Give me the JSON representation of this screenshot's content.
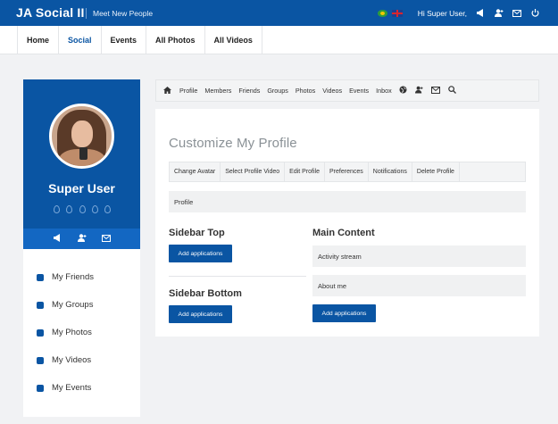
{
  "topbar": {
    "brand": "JA Social II",
    "tagline": "Meet New People",
    "greeting": "Hi Super User,"
  },
  "mainnav": {
    "items": [
      {
        "label": "Home"
      },
      {
        "label": "Social",
        "active": true
      },
      {
        "label": "Events"
      },
      {
        "label": "All Photos"
      },
      {
        "label": "All Videos"
      }
    ]
  },
  "sidebar": {
    "username": "Super User",
    "links": [
      {
        "label": "My Friends",
        "icon": "friends-icon"
      },
      {
        "label": "My Groups",
        "icon": "groups-icon"
      },
      {
        "label": "My Photos",
        "icon": "photos-icon"
      },
      {
        "label": "My Videos",
        "icon": "videos-icon"
      },
      {
        "label": "My Events",
        "icon": "events-icon"
      }
    ]
  },
  "subnav": {
    "items": [
      "Profile",
      "Members",
      "Friends",
      "Groups",
      "Photos",
      "Videos",
      "Events",
      "Inbox"
    ]
  },
  "page": {
    "title": "Customize My Profile",
    "tabs": [
      "Change Avatar",
      "Select Profile Video",
      "Edit Profile",
      "Preferences",
      "Notifications",
      "Delete Profile"
    ],
    "profile_label": "Profile",
    "sidebar_top": "Sidebar Top",
    "sidebar_bottom": "Sidebar Bottom",
    "main_content": "Main Content",
    "add_applications": "Add applications",
    "main_slots": [
      "Activity stream",
      "About me"
    ]
  },
  "colors": {
    "primary": "#0a55a3",
    "primary_light": "#1367c2",
    "background": "#f1f2f4"
  }
}
